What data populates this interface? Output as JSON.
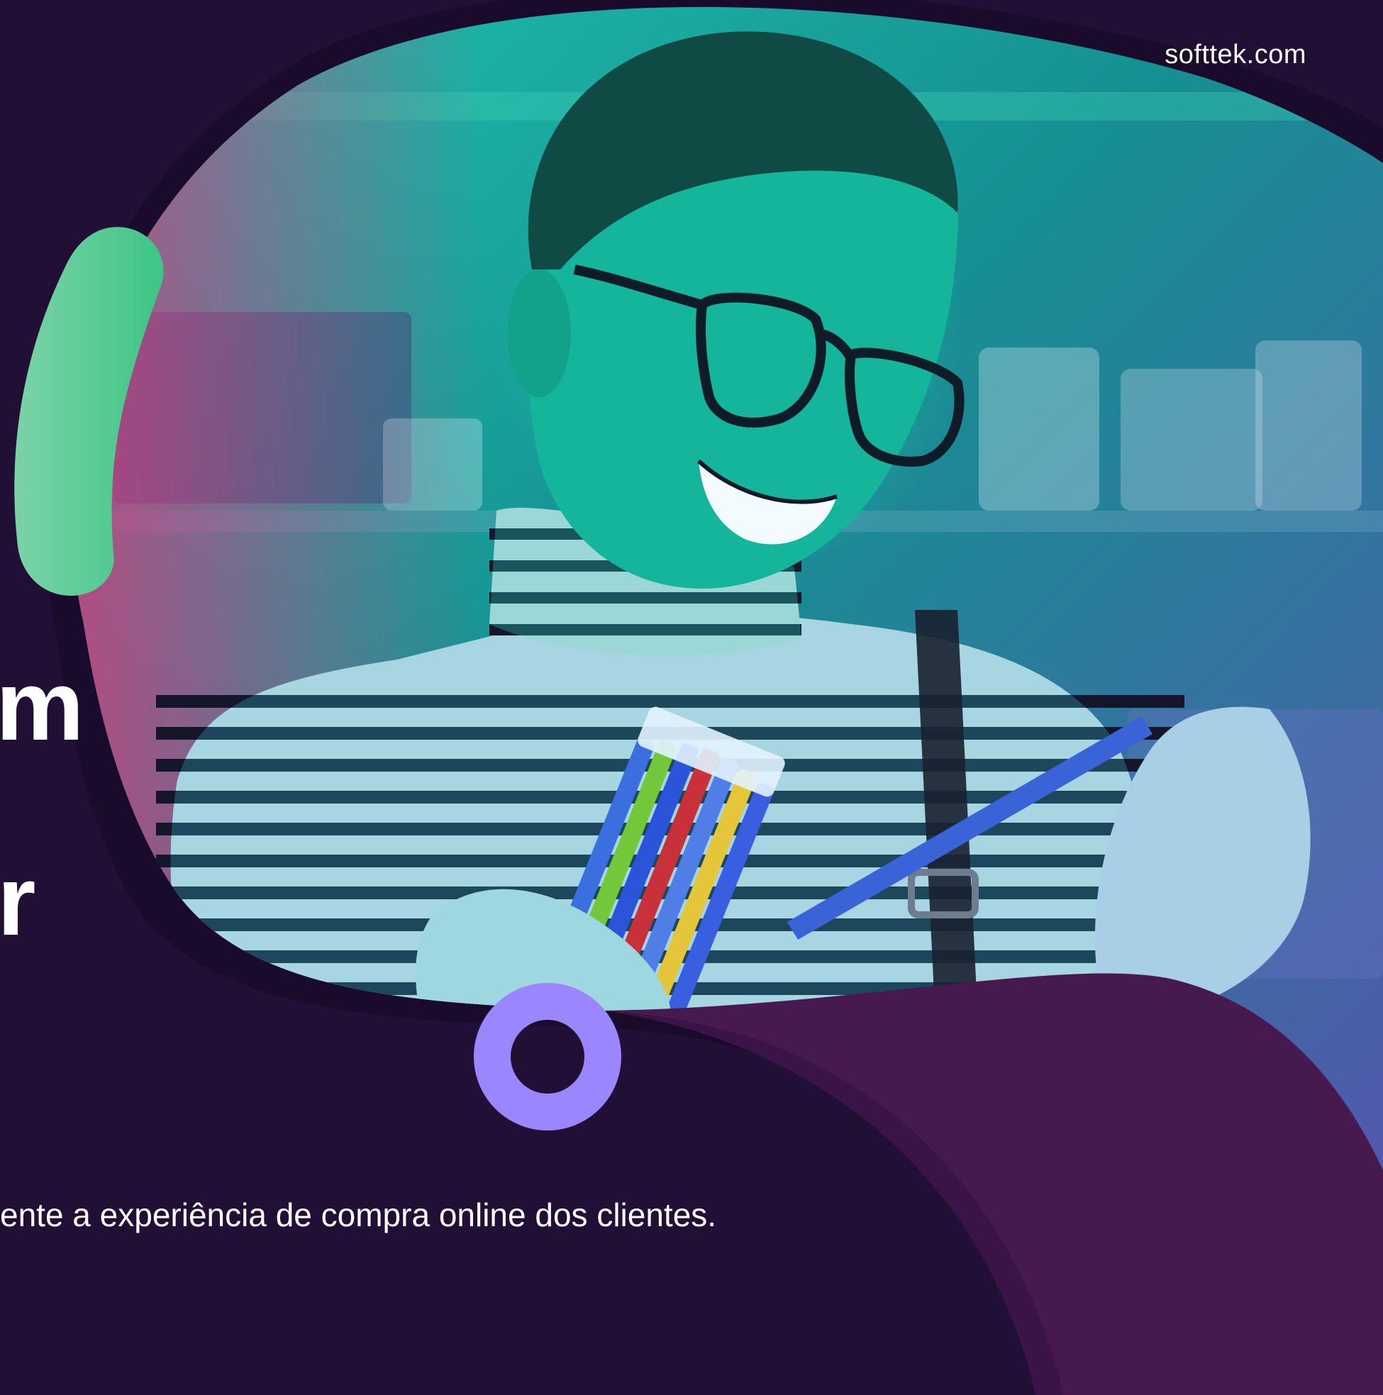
{
  "brand": {
    "url": "softtek.com"
  },
  "headline": {
    "line1_fragment": "m",
    "line2_fragment": "r"
  },
  "subtitle": "ente a experiência de compra online dos clientes.",
  "colors": {
    "background": "#220f35",
    "accent_green": "#5fd39b",
    "ring_purple": "#9a87ff",
    "wave_purple": "#461a4f",
    "photo_overlay_teal": "#1ec9b0",
    "photo_overlay_pink": "#e02f7a"
  }
}
